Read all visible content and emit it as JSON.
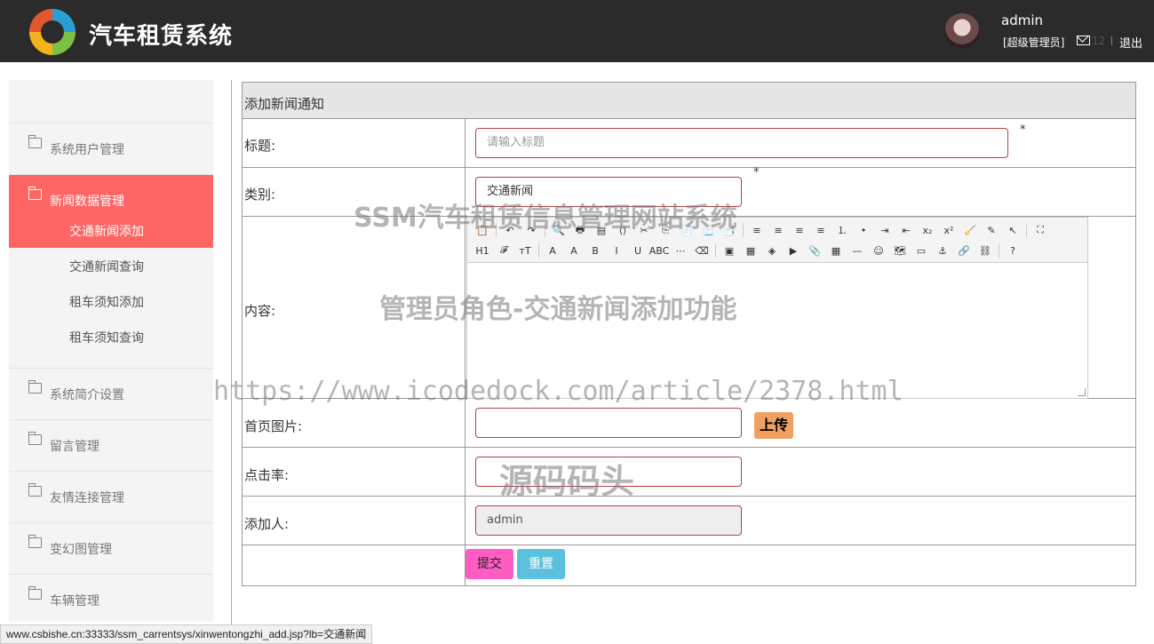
{
  "header": {
    "title": "汽车租赁系统",
    "user_name": "admin",
    "user_role": "[超级管理员]",
    "mail_count": "12",
    "logout_label": "退出"
  },
  "sidebar": {
    "groups": [
      {
        "label": "系统用户管理",
        "icon": "folder-icon"
      },
      {
        "label": "新闻数据管理",
        "icon": "folder-icon",
        "active": true
      },
      {
        "label": "系统简介设置",
        "icon": "folder-icon"
      },
      {
        "label": "留言管理",
        "icon": "folder-icon"
      },
      {
        "label": "友情连接管理",
        "icon": "folder-icon"
      },
      {
        "label": "变幻图管理",
        "icon": "folder-icon"
      },
      {
        "label": "车辆管理",
        "icon": "folder-icon"
      }
    ],
    "sub_items": [
      {
        "label": "交通新闻添加",
        "active": true
      },
      {
        "label": "交通新闻查询"
      },
      {
        "label": "租车须知添加"
      },
      {
        "label": "租车须知查询"
      }
    ]
  },
  "form": {
    "heading": "添加新闻通知",
    "title_label": "标题:",
    "title_placeholder": "请输入标题",
    "category_label": "类别:",
    "category_value": "交通新闻",
    "content_label": "内容:",
    "image_label": "首页图片:",
    "upload_label": "上传",
    "clicks_label": "点击率:",
    "author_label": "添加人:",
    "author_value": "admin",
    "required_mark": "*",
    "submit_label": "提交",
    "reset_label": "重置"
  },
  "editor": {
    "toolbar_row1": [
      "clipboard-icon",
      "undo-icon",
      "redo-icon",
      "preview-icon",
      "print-icon",
      "template-icon",
      "code-icon",
      "cut-icon",
      "copy-icon",
      "paste-icon",
      "paste-text-icon",
      "paste-word-icon",
      "align-left-icon",
      "align-center-icon",
      "align-right-icon",
      "justify-icon",
      "ordered-list-icon",
      "unordered-list-icon",
      "indent-icon",
      "outdent-icon",
      "subscript-icon",
      "superscript-icon",
      "clear-format-icon",
      "select-all-icon",
      "pointer-icon",
      "fullscreen-icon"
    ],
    "toolbar_row2": [
      "heading-icon",
      "font-family-icon",
      "font-size-icon",
      "font-color-icon",
      "highlight-icon",
      "bold-icon",
      "italic-icon",
      "underline-icon",
      "strikethrough-icon",
      "line-height-icon",
      "eraser-icon",
      "image-icon",
      "multi-image-icon",
      "flash-icon",
      "media-icon",
      "attach-icon",
      "table-icon",
      "hr-icon",
      "emoticon-icon",
      "map-icon",
      "page-break-icon",
      "anchor-icon",
      "link-icon",
      "unlink-icon",
      "help-icon"
    ],
    "toolbar_glyphs_row1": [
      "📋",
      "↶",
      "↷",
      "🔍",
      "🖶",
      "▤",
      "⟨⟩",
      "✂",
      "⎘",
      "📄",
      "📃",
      "📑",
      "≡",
      "≡",
      "≡",
      "≡",
      "⒈",
      "•",
      "⇥",
      "⇤",
      "x₂",
      "x²",
      "🧹",
      "✎",
      "↖",
      "⛶"
    ],
    "toolbar_glyphs_row2": [
      "H1",
      "𝓕",
      "тT",
      "A",
      "A",
      "B",
      "I",
      "U",
      "ABC",
      "⋯",
      "⌫",
      "▣",
      "▦",
      "◈",
      "▶",
      "📎",
      "▦",
      "—",
      "☺",
      "🗺",
      "▭",
      "⚓",
      "🔗",
      "⛓",
      "?"
    ]
  },
  "watermarks": [
    "SSM汽车租赁信息管理网站系统",
    "管理员角色-交通新闻添加功能",
    "https://www.icodedock.com/article/2378.html",
    "源码码头"
  ],
  "status_bar": {
    "url": "www.csbishe.cn:33333/ssm_carrentsys/xinwentongzhi_add.jsp?lb=交通新闻"
  }
}
